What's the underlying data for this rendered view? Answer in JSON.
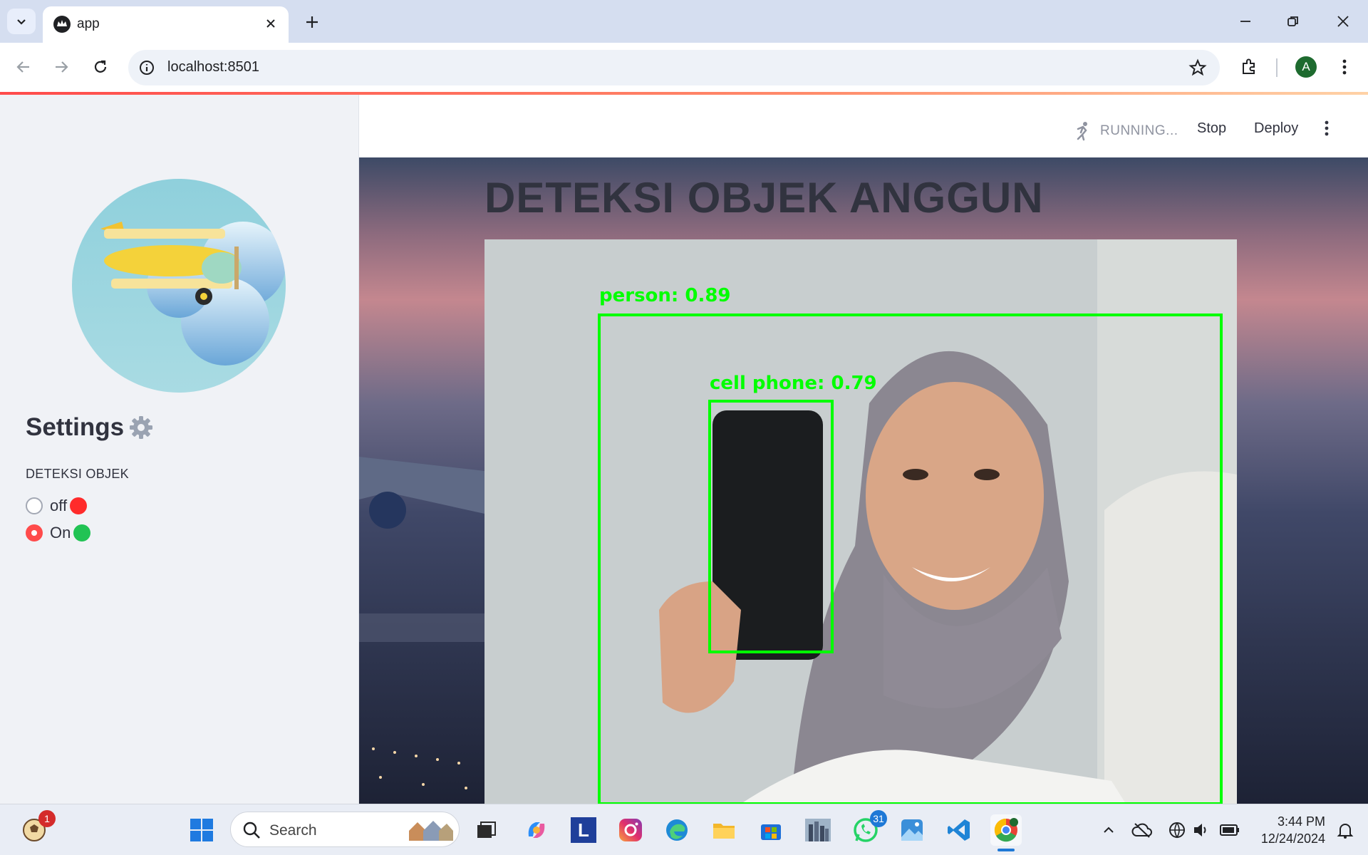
{
  "browser": {
    "tab_title": "app",
    "url": "localhost:8501",
    "profile_initial": "A"
  },
  "app": {
    "status_text": "RUNNING...",
    "stop_label": "Stop",
    "deploy_label": "Deploy",
    "page_title": "DETEKSI OBJEK ANGGUN",
    "sidebar": {
      "settings_title": "Settings",
      "settings_icon": "gear-icon",
      "group_label": "DETEKSI OBJEK",
      "options": [
        {
          "label": "off",
          "indicator_color": "#ff2b2b",
          "selected": false
        },
        {
          "label": "On",
          "indicator_color": "#21c354",
          "selected": true
        }
      ]
    },
    "detections": [
      {
        "label": "person: 0.89"
      },
      {
        "label": "cell phone: 0.79"
      }
    ],
    "accent_color": "#ff4b4b",
    "bbox_color": "#00ff00"
  },
  "taskbar": {
    "search_placeholder": "Search",
    "widgets_badge": "1",
    "whatsapp_badge": "31",
    "time": "3:44 PM",
    "date": "12/24/2024"
  }
}
